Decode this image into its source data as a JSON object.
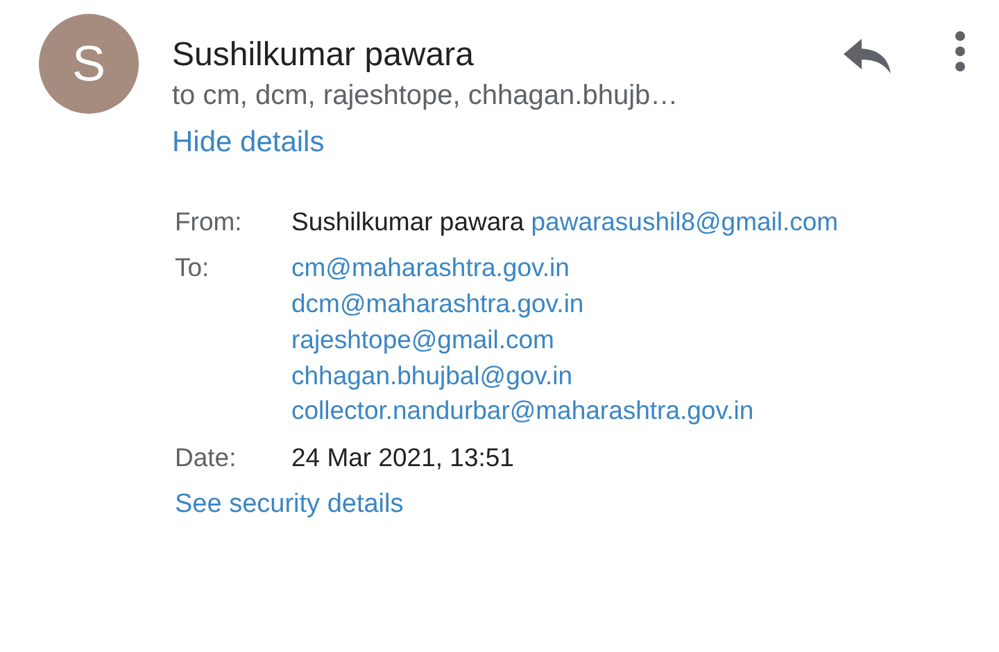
{
  "header": {
    "avatar": {
      "letter": "S",
      "color": "#a58c7f"
    },
    "sender": "Sushilkumar pawara",
    "recipients_summary": "to cm, dcm, rajeshtope, chhagan.bhujb…",
    "toggle_link": "Hide details"
  },
  "details": {
    "from": {
      "label": "From:",
      "name": "Sushilkumar pawara",
      "email": "pawarasushil8@gmail.com"
    },
    "to": {
      "label": "To:",
      "addresses": [
        "cm@maharashtra.gov.in",
        "dcm@maharashtra.gov.in",
        "rajeshtope@gmail.com",
        "chhagan.bhujbal@gov.in",
        "collector.nandurbar@maharashtra.gov.in"
      ]
    },
    "date": {
      "label": "Date:",
      "value": "24 Mar 2021, 13:51"
    }
  },
  "security_link": "See security details"
}
